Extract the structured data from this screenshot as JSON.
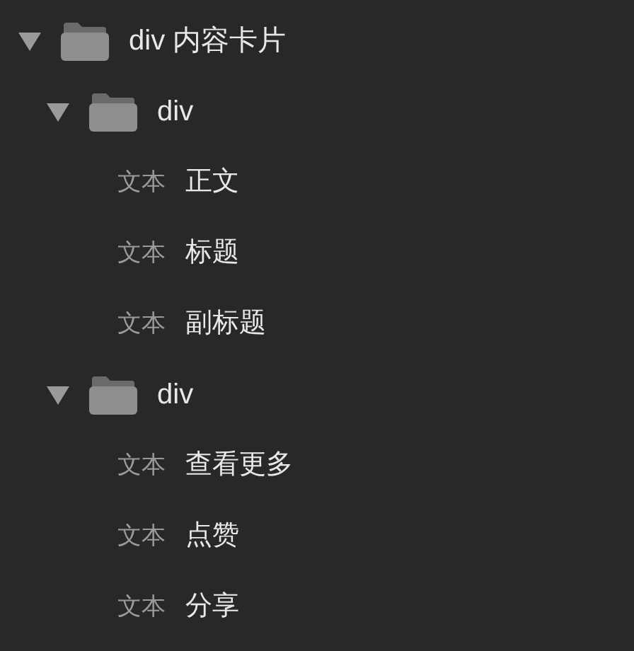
{
  "tree": [
    {
      "kind": "folder",
      "label": "div 内容卡片",
      "expanded": true,
      "children": [
        {
          "kind": "folder",
          "label": "div",
          "expanded": true,
          "children": [
            {
              "kind": "text",
              "type_label": "文本",
              "label": "正文"
            },
            {
              "kind": "text",
              "type_label": "文本",
              "label": "标题"
            },
            {
              "kind": "text",
              "type_label": "文本",
              "label": "副标题"
            }
          ]
        },
        {
          "kind": "folder",
          "label": "div",
          "expanded": true,
          "children": [
            {
              "kind": "text",
              "type_label": "文本",
              "label": "查看更多"
            },
            {
              "kind": "text",
              "type_label": "文本",
              "label": "点赞"
            },
            {
              "kind": "text",
              "type_label": "文本",
              "label": "分享"
            }
          ]
        }
      ]
    }
  ]
}
